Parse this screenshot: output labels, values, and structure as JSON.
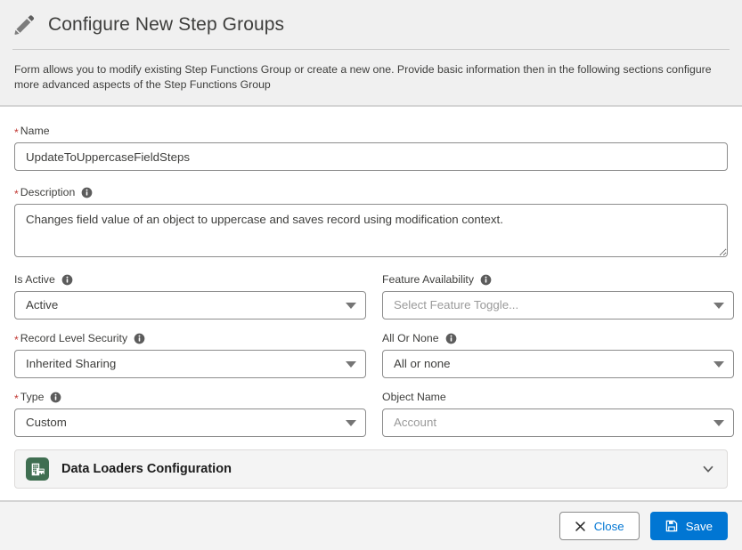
{
  "header": {
    "icon": "pencil-icon",
    "title": "Configure New Step Groups"
  },
  "intro": {
    "text": "Form allows you to modify existing Step Functions Group or create a new one. Provide basic information then in the following sections configure more advanced aspects of the Step Functions Group"
  },
  "form": {
    "name": {
      "label": "Name",
      "required": true,
      "value": "UpdateToUppercaseFieldSteps"
    },
    "description": {
      "label": "Description",
      "required": true,
      "has_info": true,
      "value": "Changes field value of an object to uppercase and saves record using modification context."
    },
    "is_active": {
      "label": "Is Active",
      "required": false,
      "has_info": true,
      "value": "Active"
    },
    "feature_availability": {
      "label": "Feature Availability",
      "required": false,
      "has_info": true,
      "value": "Select Feature Toggle...",
      "is_placeholder": true
    },
    "record_level_security": {
      "label": "Record Level Security",
      "required": true,
      "has_info": true,
      "value": "Inherited Sharing"
    },
    "all_or_none": {
      "label": "All Or None",
      "required": false,
      "has_info": true,
      "value": "All or none"
    },
    "type": {
      "label": "Type",
      "required": true,
      "has_info": true,
      "value": "Custom"
    },
    "object_name": {
      "label": "Object Name",
      "required": false,
      "has_info": false,
      "value": "Account",
      "is_placeholder": true
    }
  },
  "section": {
    "icon": "building-store-icon",
    "title": "Data Loaders Configuration",
    "expand_icon": "chevron-down-icon",
    "expanded": false
  },
  "footer": {
    "close": {
      "label": "Close",
      "icon": "close-x-icon"
    },
    "save": {
      "label": "Save",
      "icon": "save-disk-icon"
    }
  },
  "colors": {
    "accent_blue": "#0176d3",
    "required_red": "#c23934",
    "section_green": "#3f6e51",
    "page_bg": "#f0f0f0",
    "card_bg": "#ffffff"
  }
}
